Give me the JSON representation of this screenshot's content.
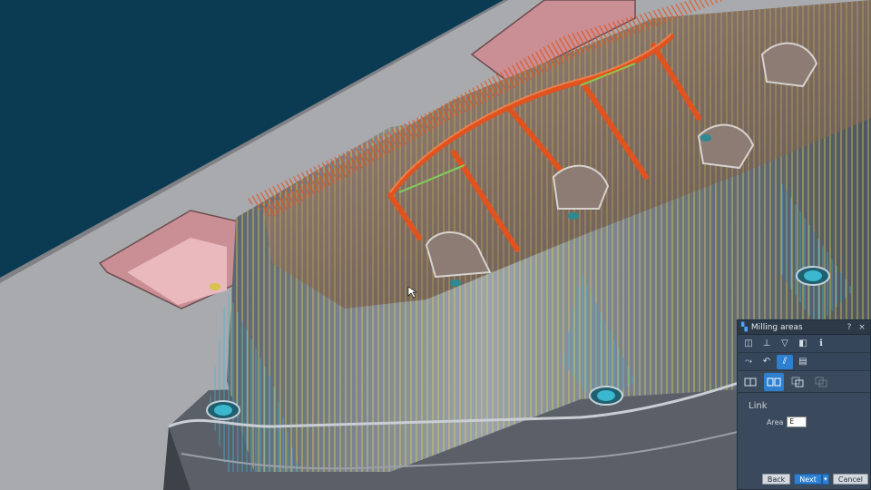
{
  "dialog": {
    "title": "Milling areas",
    "help_label": "?",
    "close_label": "×",
    "section_label": "Link",
    "area_label": "Area",
    "area_value": "E",
    "back_label": "Back",
    "next_label": "Next",
    "next_caret": "▾",
    "cancel_label": "Cancel"
  },
  "toolbar_row1": [
    "view-3d-icon",
    "axis-icon",
    "funnel-icon",
    "cube-icon",
    "info-icon"
  ],
  "toolbar_row2": [
    "path-icon",
    "curve-arrow-icon",
    "hatch-icon",
    "page-edit-icon"
  ],
  "mode_row": [
    "single-area-icon",
    "dual-area-icon",
    "overlap-area-icon",
    "offset-area-icon"
  ],
  "colors": {
    "background": "#0a3b52",
    "floor": "#a9aaae",
    "accent": "#2f7fd0",
    "toolpath_orange": "#e0531f",
    "toolpath_yellow": "#e6d24a",
    "toolpath_cyan": "#3ab7e0"
  }
}
